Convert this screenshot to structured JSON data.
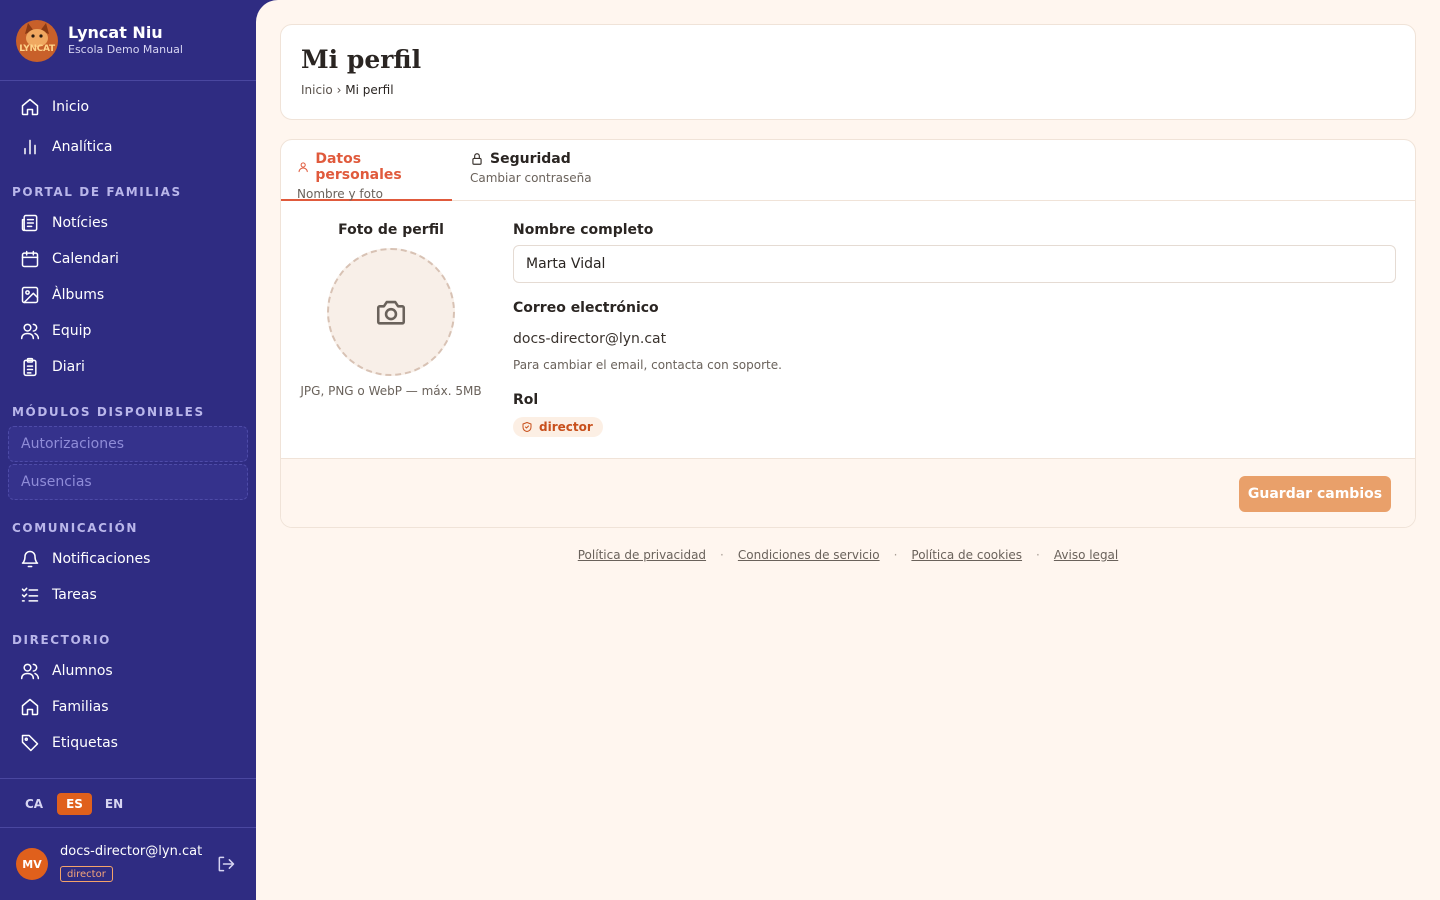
{
  "brand": {
    "name": "Lyncat Niu",
    "subtitle": "Escola Demo Manual",
    "logo_text": "LYNCAT"
  },
  "sidebar": {
    "main_items": [
      {
        "label": "Inicio",
        "icon": "home-icon"
      },
      {
        "label": "Analítica",
        "icon": "bar-chart-icon"
      }
    ],
    "sections": [
      {
        "title": "PORTAL DE FAMILIAS",
        "items": [
          {
            "label": "Notícies",
            "icon": "newspaper-icon"
          },
          {
            "label": "Calendari",
            "icon": "calendar-icon"
          },
          {
            "label": "Àlbums",
            "icon": "image-icon"
          },
          {
            "label": "Equip",
            "icon": "users-icon"
          },
          {
            "label": "Diari",
            "icon": "clipboard-icon"
          }
        ]
      },
      {
        "title": "MÓDULOS DISPONIBLES",
        "modules": [
          {
            "label": "Autorizaciones"
          },
          {
            "label": "Ausencias"
          }
        ]
      },
      {
        "title": "COMUNICACIÓN",
        "items": [
          {
            "label": "Notificaciones",
            "icon": "bell-icon"
          },
          {
            "label": "Tareas",
            "icon": "list-checks-icon"
          }
        ]
      },
      {
        "title": "DIRECTORIO",
        "items": [
          {
            "label": "Alumnos",
            "icon": "users-icon"
          },
          {
            "label": "Familias",
            "icon": "home-icon"
          },
          {
            "label": "Etiquetas",
            "icon": "tag-icon"
          }
        ]
      }
    ],
    "languages": [
      "CA",
      "ES",
      "EN"
    ],
    "active_language": "ES",
    "user": {
      "initials": "MV",
      "email": "docs-director@lyn.cat",
      "role": "director"
    }
  },
  "header": {
    "title": "Mi perfil",
    "breadcrumb_home": "Inicio",
    "breadcrumb_sep": "›",
    "breadcrumb_current": "Mi perfil"
  },
  "tabs": [
    {
      "title": "Datos personales",
      "subtitle": "Nombre y foto",
      "icon": "user-icon",
      "active": true
    },
    {
      "title": "Seguridad",
      "subtitle": "Cambiar contraseña",
      "icon": "lock-icon",
      "active": false
    }
  ],
  "profile": {
    "photo_label": "Foto de perfil",
    "photo_hint": "JPG, PNG o WebP — máx. 5MB",
    "name_label": "Nombre completo",
    "name_value": "Marta Vidal",
    "email_label": "Correo electrónico",
    "email_value": "docs-director@lyn.cat",
    "email_hint": "Para cambiar el email, contacta con soporte.",
    "role_label": "Rol",
    "role_value": "director",
    "save_label": "Guardar cambios"
  },
  "footer": {
    "links": [
      "Política de privacidad",
      "Condiciones de servicio",
      "Política de cookies",
      "Aviso legal"
    ],
    "separator": "·"
  },
  "colors": {
    "sidebar_bg": "#2f2c82",
    "accent": "#e05a3c",
    "save_button": "#e9a06a",
    "main_bg": "#fff6ef",
    "lang_active": "#e0601c"
  }
}
